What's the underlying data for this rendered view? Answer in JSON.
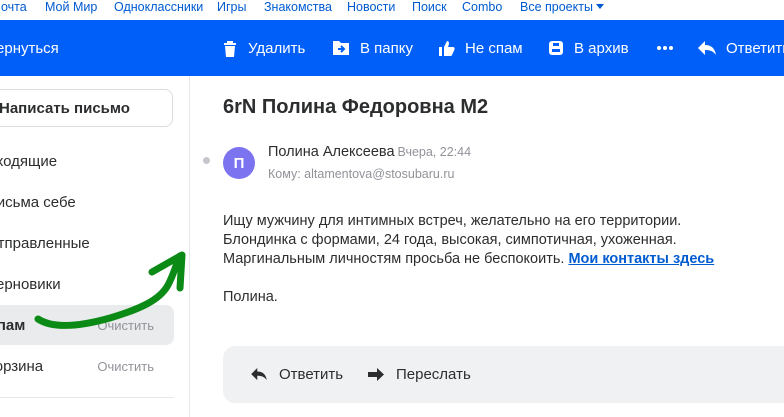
{
  "portal_nav": {
    "items": [
      "Почта",
      "Мой Мир",
      "Одноклассники",
      "Игры",
      "Знакомства",
      "Новости",
      "Поиск",
      "Combo",
      "Все проекты"
    ]
  },
  "toolbar": {
    "back_label": "Вернуться",
    "delete_label": "Удалить",
    "move_label": "В папку",
    "not_spam_label": "Не спам",
    "archive_label": "В архив",
    "reply_label": "Ответить"
  },
  "sidebar": {
    "compose_label": "Написать письмо",
    "folders": [
      {
        "label": "Входящие",
        "clear": ""
      },
      {
        "label": "Письма себе",
        "clear": ""
      },
      {
        "label": "Отправленные",
        "clear": ""
      },
      {
        "label": "Черновики",
        "clear": ""
      },
      {
        "label": "Спам",
        "clear": "Очистить"
      },
      {
        "label": "Корзина",
        "clear": "Очистить"
      }
    ]
  },
  "message": {
    "subject": "6rN Полина Федоровна M2",
    "avatar_letter": "П",
    "sender_name": "Полина Алексеева",
    "date": "Вчера, 22:44",
    "recipient": "Кому: altamentova@stosubaru.ru",
    "body_lines": [
      "Ищу мужчину для интимных встреч, желательно на его территории.",
      "Блондинка с формами, 24 года, высокая, симпотичная, ухоженная.",
      "Маргинальным личностям просьба не беспокоить."
    ],
    "body_link": "Мои контакты здесь",
    "signature": "Полина."
  },
  "reply_bar": {
    "reply_label": "Ответить",
    "forward_label": "Переслать"
  },
  "colors": {
    "toolbar_blue": "#005ff9",
    "link_blue": "#005bd1",
    "avatar_purple": "#7b73f0",
    "annotation_green": "#0b8a16"
  }
}
